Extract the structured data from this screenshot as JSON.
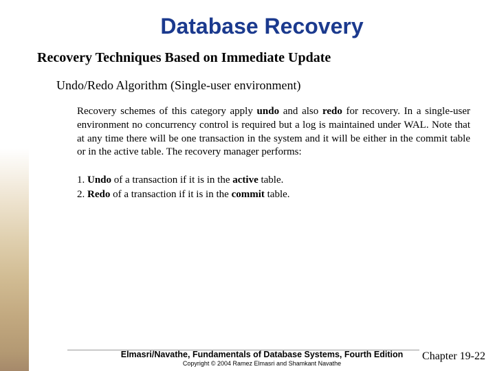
{
  "title": "Database Recovery",
  "subtitle": "Recovery Techniques Based on Immediate Update",
  "subsubtitle": "Undo/Redo Algorithm (Single-user environment)",
  "paragraph": {
    "pre1": "Recovery schemes of this category apply ",
    "b1": "undo",
    "mid1": " and also ",
    "b2": "redo",
    "post1": " for recovery.  In a single-user environment no concurrency control is required but a log is maintained under WAL. Note that at any time there will be one transaction in the system and it will be either in the commit table or in the active table.  The recovery manager performs:"
  },
  "list": [
    {
      "num": "1.",
      "label": "Undo",
      "tail_a": " of a transaction if it is in the ",
      "key": "active",
      "tail_b": " table."
    },
    {
      "num": "2.",
      "label": "Redo",
      "tail_a": " of a transaction if it is in the ",
      "key": "commit",
      "tail_b": " table."
    }
  ],
  "footer": {
    "book": "Elmasri/Navathe, Fundamentals of Database Systems, Fourth Edition",
    "copyright": "Copyright © 2004 Ramez Elmasri and Shamkant Navathe",
    "page": "Chapter 19-22"
  }
}
